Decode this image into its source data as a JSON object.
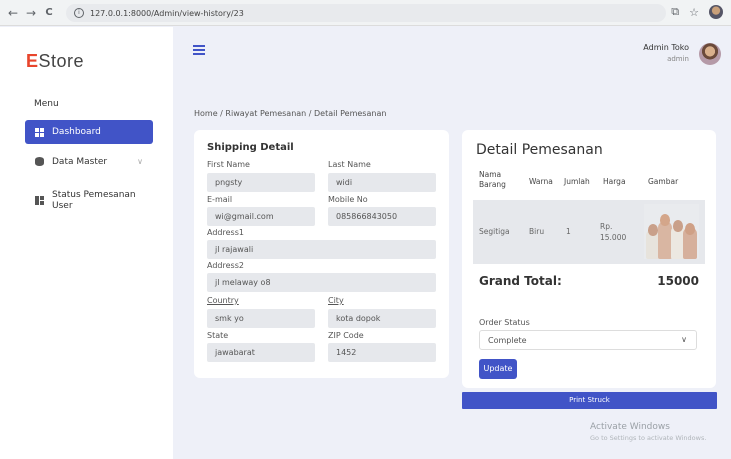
{
  "browser": {
    "url": "127.0.0.1:8000/Admin/view-history/23",
    "back_glyph": "←",
    "forward_glyph": "→",
    "reload_glyph": "C",
    "info_glyph": "i",
    "ext_glyph": "⧉",
    "star_glyph": "☆"
  },
  "sidebar": {
    "logo_initial": "E",
    "logo_rest": "Store",
    "menu_heading": "Menu",
    "items": [
      {
        "label": "Dashboard",
        "icon": "dashboard-grid-icon",
        "active": true
      },
      {
        "label": "Data Master",
        "icon": "database-icon",
        "has_submenu": true
      },
      {
        "label": "Status Pemesanan User",
        "icon": "user-order-icon"
      }
    ],
    "chevron_glyph": "∨"
  },
  "header": {
    "admin_name": "Admin Toko",
    "admin_role": "admin"
  },
  "breadcrumb": "Home / Riwayat Pemesanan / Detail Pemesanan",
  "shipping": {
    "title": "Shipping Detail",
    "first_name_label": "First Name",
    "first_name": "pngsty",
    "last_name_label": "Last Name",
    "last_name": "widi",
    "email_label": "E-mail",
    "email": "wi@gmail.com",
    "mobile_label": "Mobile No",
    "mobile": "085866843050",
    "address1_label": "Address1",
    "address1": "jl rajawali",
    "address2_label": "Address2",
    "address2": "jl melaway o8",
    "country_label": "Country",
    "country": "smk yo",
    "city_label": "City",
    "city": "kota dopok",
    "state_label": "State",
    "state": "jawabarat",
    "zip_label": "ZIP Code",
    "zip": "1452"
  },
  "order": {
    "title": "Detail Pemesanan",
    "columns": [
      "Nama Barang",
      "Warna",
      "Jumlah",
      "Harga",
      "Gambar"
    ],
    "rows": [
      {
        "nama_barang": "Segitiga",
        "warna": "Biru",
        "jumlah": "1",
        "harga": "Rp. 15.000",
        "gambar": "product-photo"
      }
    ],
    "grand_total_label": "Grand Total:",
    "grand_total_value": "15000",
    "order_status_label": "Order Status",
    "order_status_value": "Complete",
    "select_caret_glyph": "∨",
    "update_label": "Update",
    "print_label": "Print Struck"
  },
  "os_watermark": {
    "line1": "Activate Windows",
    "line2": "Go to Settings to activate Windows."
  },
  "colors": {
    "primary": "#4154c7",
    "logo_accent": "#e8452c",
    "page_bg": "#eef0f8"
  }
}
